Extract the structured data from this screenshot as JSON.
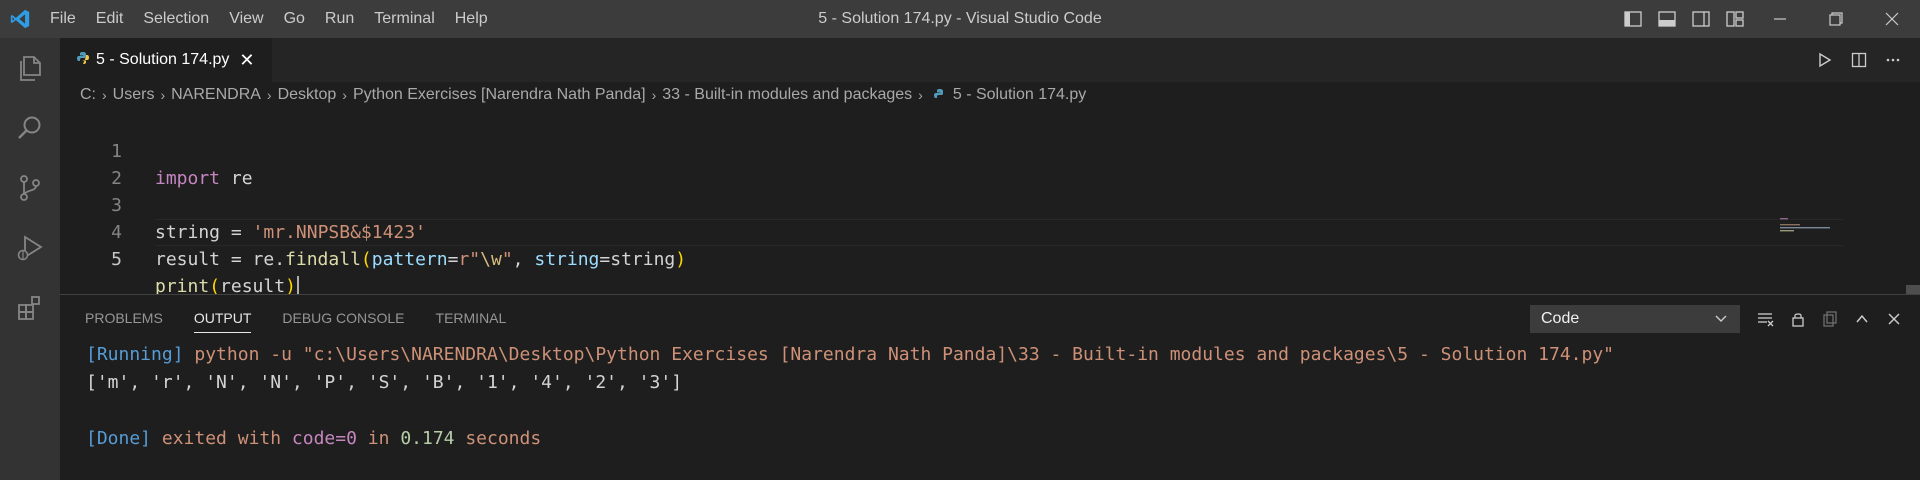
{
  "window": {
    "title": "5 - Solution 174.py - Visual Studio Code"
  },
  "menu": [
    {
      "label": "File"
    },
    {
      "label": "Edit"
    },
    {
      "label": "Selection"
    },
    {
      "label": "View"
    },
    {
      "label": "Go"
    },
    {
      "label": "Run"
    },
    {
      "label": "Terminal"
    },
    {
      "label": "Help"
    }
  ],
  "tab": {
    "label": "5 - Solution 174.py",
    "close": "✕"
  },
  "breadcrumbs": [
    "C:",
    "Users",
    "NARENDRA",
    "Desktop",
    "Python Exercises [Narendra Nath Panda]",
    "33 - Built-in modules and packages",
    "5 - Solution 174.py"
  ],
  "code": {
    "line_numbers": [
      "1",
      "2",
      "3",
      "4",
      "5"
    ],
    "l1": {
      "kw": "import",
      "rest": " re"
    },
    "l3": {
      "var": "string = ",
      "str": "'mr.NNPSB&$1423'"
    },
    "l4": {
      "a": "result = re.",
      "fn": "findall",
      "open": "(",
      "p1": "pattern",
      "eq1": "=",
      "r": "r\"",
      "rx": "\\w",
      "rq": "\"",
      "comma": ", ",
      "p2": "string",
      "eq2": "=string",
      "close": ")"
    },
    "l5": {
      "fn": "print",
      "open": "(",
      "arg": "result",
      "close": ")"
    }
  },
  "panel": {
    "tabs": [
      "PROBLEMS",
      "OUTPUT",
      "DEBUG CONSOLE",
      "TERMINAL"
    ],
    "active_tab": "OUTPUT",
    "channel": "Code",
    "output": {
      "running_tag": "[Running]",
      "running_cmd": " python -u \"c:\\Users\\NARENDRA\\Desktop\\Python Exercises [Narendra Nath Panda]\\33 - Built-in modules and packages\\5 - Solution 174.py\"",
      "result": "['m', 'r', 'N', 'N', 'P', 'S', 'B', '1', '4', '2', '3']",
      "done_tag": "[Done]",
      "done_a": " exited with ",
      "done_code": "code=0",
      "done_b": " in ",
      "done_time": "0.174",
      "done_c": " seconds"
    }
  },
  "colors": {
    "accent": "#007acc",
    "python_icon": "#519aba"
  }
}
